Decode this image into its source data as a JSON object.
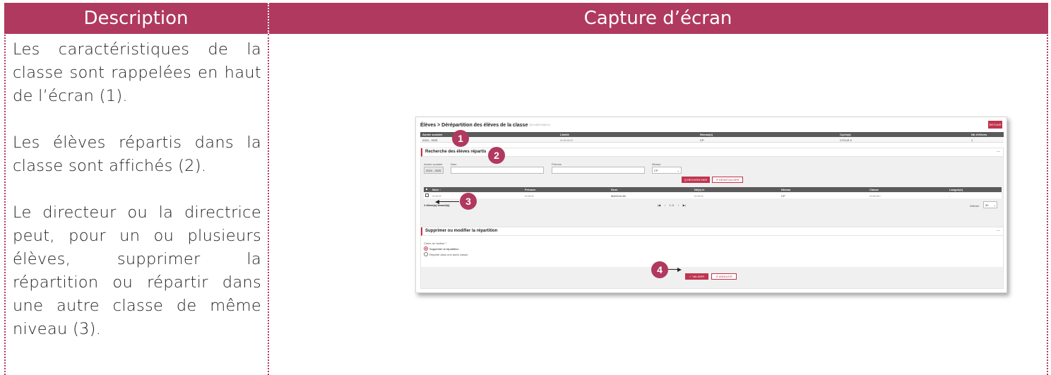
{
  "header": {
    "description": "Description",
    "capture": "Capture d’écran"
  },
  "description": {
    "paragraphs": [
      "Les caractéristiques de la classe sont rappelées en haut de l’écran (1).",
      "Les élèves répartis dans la classe sont affichés (2).",
      "Le directeur ou la directrice peut, pour un ou plusieurs élèves, supprimer la répartition ou répartir dans une autre classe de même niveau (3)."
    ]
  },
  "screenshot": {
    "title": "Élèves > Dérépartition des élèves de la classe",
    "retour": "RETOUR",
    "info_columns": [
      "Année scolaire",
      "Libellé",
      "Niveau(x)",
      "Cycle(s)",
      "Nb d’élèves"
    ],
    "info_values": [
      "2024 - 2025",
      "",
      "CP",
      "CYCLE II",
      "1"
    ],
    "search": {
      "title": "Recherche des élèves répartis",
      "collapse": "—",
      "fields": {
        "annee_label": "Année scolaire",
        "annee_value": "2024 - 2025",
        "nom_label": "Nom",
        "prenom_label": "Prénom",
        "niveau_label": "Niveau",
        "niveau_value": "CP"
      },
      "search_button": "Q RECHERCHER",
      "reset_button": "↺ RÉINITIALISER"
    },
    "table": {
      "columns": [
        "Nom ↑",
        "Prénom",
        "Sexe",
        "Né(e) le",
        "Niveau",
        "Classe",
        "Langue(s)"
      ],
      "rows": [
        {
          "sexe": "MASCULIN",
          "niveau": "CP",
          "langues": "-"
        }
      ],
      "count": "1 élève(s) trouvé(s)",
      "pager": "|◀     ‹     1 /1     ›     ▶|",
      "afficher_label": "Afficher",
      "afficher_value": "30"
    },
    "action": {
      "title": "Supprimer ou modifier la répartition",
      "collapse": "—",
      "label": "Choix de l’action *",
      "options": [
        "Supprimer la répartition",
        "Répartir dans une autre classe"
      ],
      "valider": "✓ VALIDER",
      "annuler": "✕ ANNULER"
    }
  },
  "markers": [
    "1",
    "2",
    "3",
    "4"
  ],
  "colors": {
    "accent": "#b0395f",
    "button": "#c0344d",
    "table_header": "#5a5a5a"
  }
}
